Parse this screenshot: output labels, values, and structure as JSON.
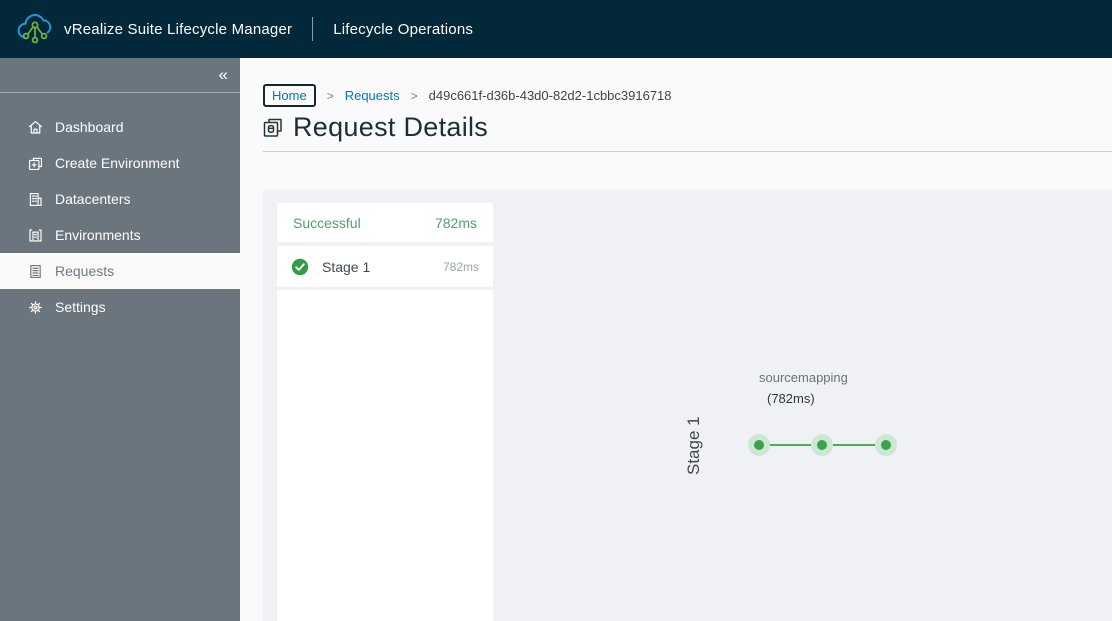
{
  "header": {
    "product": "vRealize Suite Lifecycle Manager",
    "module": "Lifecycle Operations"
  },
  "sidebar": {
    "collapse_glyph": "«",
    "items": [
      {
        "label": "Dashboard",
        "icon": "home-icon",
        "active": false
      },
      {
        "label": "Create Environment",
        "icon": "create-environment-icon",
        "active": false
      },
      {
        "label": "Datacenters",
        "icon": "datacenter-icon",
        "active": false
      },
      {
        "label": "Environments",
        "icon": "environment-icon",
        "active": false
      },
      {
        "label": "Requests",
        "icon": "requests-icon",
        "active": true
      },
      {
        "label": "Settings",
        "icon": "gear-icon",
        "active": false
      }
    ]
  },
  "breadcrumb": {
    "separator": ">",
    "home": "Home",
    "requests": "Requests",
    "request_id": "d49c661f-d36b-43d0-82d2-1cbbc3916718"
  },
  "page": {
    "title": "Request Details"
  },
  "stages_panel": {
    "status": "Successful",
    "total_duration": "782ms",
    "stages": [
      {
        "name": "Stage 1",
        "duration": "782ms",
        "status": "success"
      }
    ]
  },
  "graph": {
    "stage_label": "Stage 1",
    "task_name": "sourcemapping",
    "task_duration": "(782ms)",
    "node_count": 3
  },
  "colors": {
    "header_bg": "#03283a",
    "sidebar_bg": "#6a757e",
    "panel_bg": "#f0f1f4",
    "success_green": "#4da167",
    "check_green": "#2f9e44",
    "node_green": "#3aa24c",
    "node_halo": "#cde8d1",
    "link_blue": "#0079b8"
  }
}
